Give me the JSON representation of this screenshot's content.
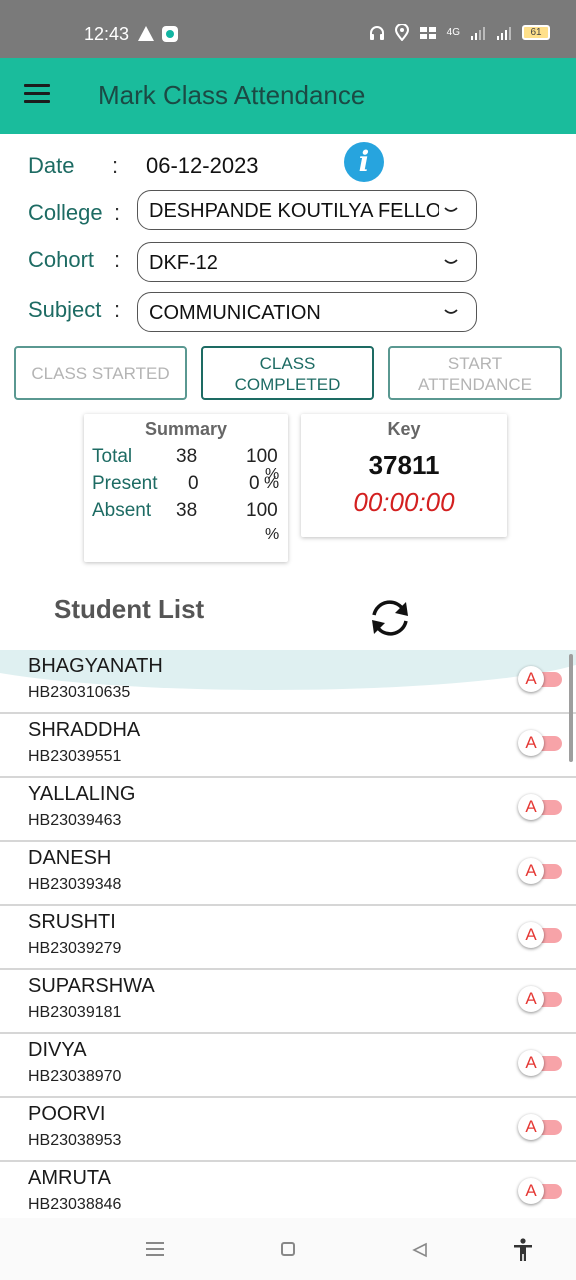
{
  "status_bar": {
    "time": "12:43",
    "icons": [
      "warning-icon",
      "chat-icon",
      "headset-icon",
      "location-icon",
      "volte-icon",
      "signal-4g-icon",
      "signal-icon"
    ],
    "network_label": "4G",
    "battery": "61"
  },
  "app_bar": {
    "title": "Mark Class Attendance",
    "menu_icon": "hamburger-menu-icon"
  },
  "form": {
    "date_label": "Date",
    "date_value": "06-12-2023",
    "colon": ":",
    "info_icon_glyph": "i",
    "college_label": "College",
    "college_value": "DESHPANDE KOUTILYA FELLO...",
    "cohort_label": "Cohort",
    "cohort_value": "DKF-12",
    "subject_label": "Subject",
    "subject_value": "COMMUNICATION"
  },
  "buttons": {
    "class_started": "CLASS STARTED",
    "class_completed_line1": "CLASS",
    "class_completed_line2": "COMPLETED",
    "start_attendance_line1": "START",
    "start_attendance_line2": "ATTENDANCE"
  },
  "summary": {
    "title": "Summary",
    "rows": [
      {
        "label": "Total",
        "count": "38",
        "percent": "100",
        "unit": "%"
      },
      {
        "label": "Present",
        "count": "0",
        "percent": "0",
        "unit": "%"
      },
      {
        "label": "Absent",
        "count": "38",
        "percent": "100",
        "unit": "%"
      }
    ]
  },
  "key": {
    "title": "Key",
    "value": "37811",
    "timer": "00:00:00"
  },
  "student_list": {
    "heading": "Student List",
    "refresh_icon": "refresh-icon",
    "toggle_label": "A",
    "students": [
      {
        "name": "BHAGYANATH",
        "id": "HB230310635"
      },
      {
        "name": "SHRADDHA",
        "id": "HB23039551"
      },
      {
        "name": "YALLALING",
        "id": "HB23039463"
      },
      {
        "name": "DANESH",
        "id": "HB23039348"
      },
      {
        "name": "SRUSHTI",
        "id": "HB23039279"
      },
      {
        "name": "SUPARSHWA",
        "id": "HB23039181"
      },
      {
        "name": "DIVYA",
        "id": "HB23038970"
      },
      {
        "name": "POORVI",
        "id": "HB23038953"
      },
      {
        "name": "AMRUTA",
        "id": "HB23038846"
      }
    ]
  },
  "colors": {
    "app_bar": "#1abc9c",
    "label_text": "#1d6b63",
    "timer_text": "#d32020",
    "toggle_off_track": "#f7a3a8",
    "info_icon": "#27a4de"
  },
  "nav_bar": {
    "icons": [
      "recents-icon",
      "home-icon",
      "back-icon",
      "accessibility-icon"
    ]
  }
}
